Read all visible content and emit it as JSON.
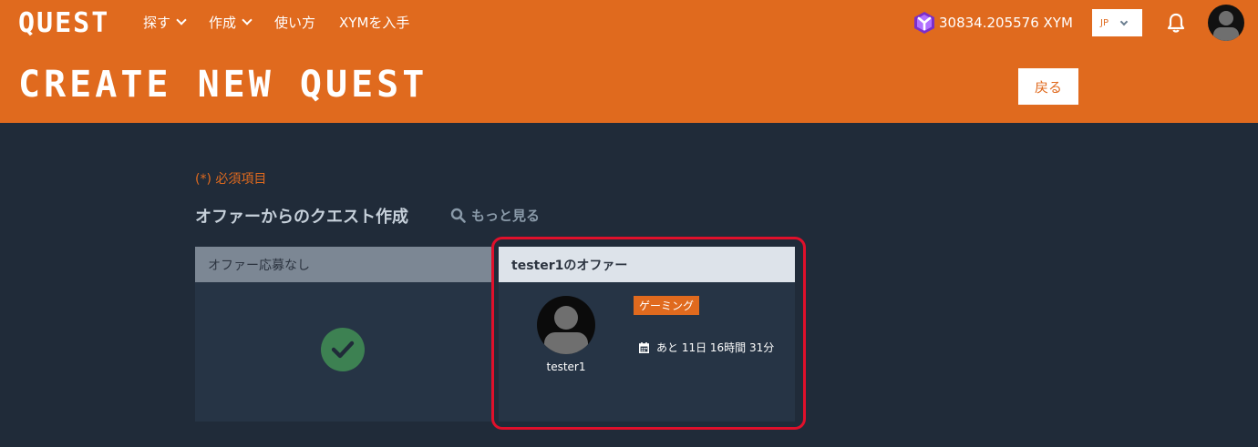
{
  "header": {
    "logo": "QUEST",
    "nav": [
      {
        "label": "探す",
        "dropdown": true
      },
      {
        "label": "作成",
        "dropdown": true
      },
      {
        "label": "使い方",
        "dropdown": false
      },
      {
        "label": "XYMを入手",
        "dropdown": false
      }
    ],
    "balance": "30834.205576 XYM",
    "balance_icon": "symbol-logo-icon",
    "language": "JP",
    "title": "CREATE NEW QUEST",
    "back_label": "戻る"
  },
  "main": {
    "required_note": "(*) 必須項目",
    "section_title": "オファーからのクエスト作成",
    "more_label": "もっと見る",
    "cards": [
      {
        "header": "オファー応募なし",
        "icon": "check-circle-icon"
      },
      {
        "header": "tester1のオファー",
        "username": "tester1",
        "tag": "ゲーミング",
        "deadline": "あと 11日 16時間 31分",
        "deadline_icon": "calendar-icon"
      }
    ]
  },
  "colors": {
    "brand_orange": "#e06a1e",
    "background": "#202b39",
    "card": "#263445",
    "highlight_red": "#e0102b",
    "check_green": "#3d8152"
  }
}
